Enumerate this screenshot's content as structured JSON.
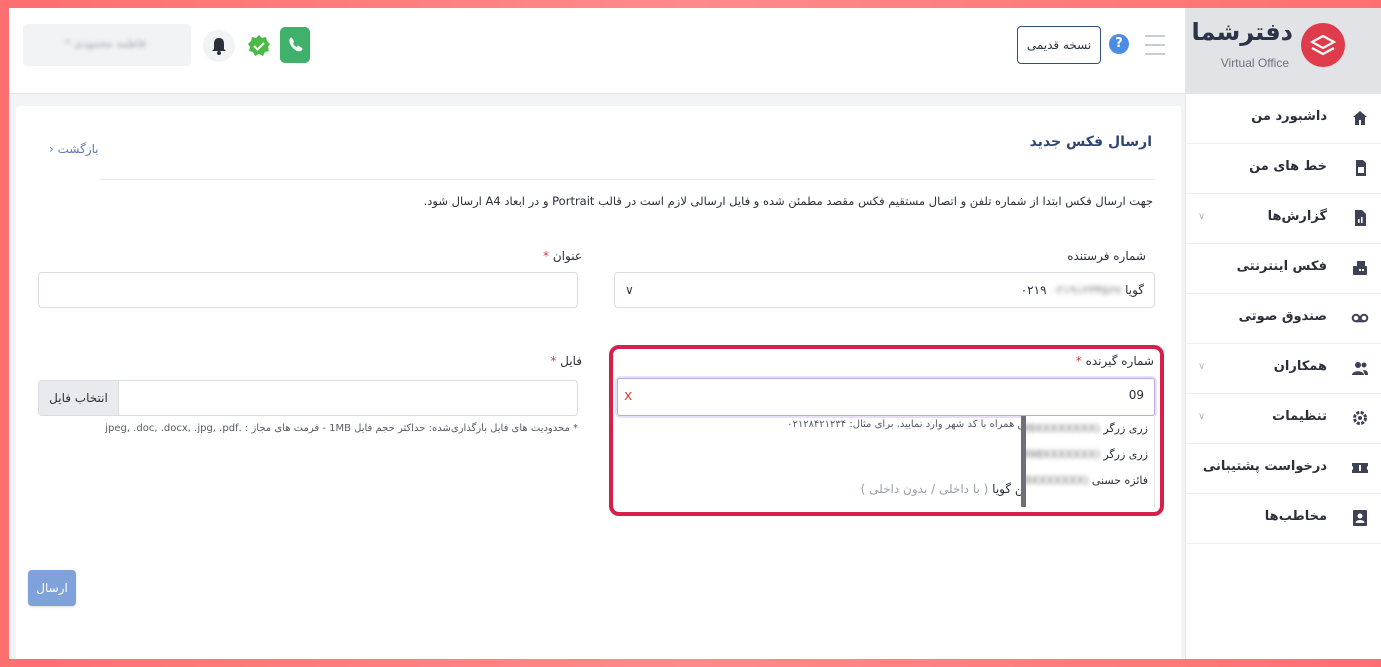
{
  "brand": {
    "name": "دفترشما",
    "subtitle": "Virtual Office",
    "color": "#e03b4b"
  },
  "header": {
    "user_name": "فاطمه محمودی *",
    "old_version_label": "نسخه قدیمی",
    "help_glyph": "?",
    "icons": [
      "menu-icon",
      "help-icon",
      "phone-icon",
      "verified-icon",
      "bell-icon"
    ]
  },
  "sidebar": {
    "items": [
      {
        "label": "داشبورد من",
        "icon": "home-icon",
        "has_submenu": false
      },
      {
        "label": "خط های من",
        "icon": "sim-card-icon",
        "has_submenu": false
      },
      {
        "label": "گزارش‌ها",
        "icon": "report-icon",
        "has_submenu": true
      },
      {
        "label": "فکس اینترنتی",
        "icon": "fax-icon",
        "has_submenu": false
      },
      {
        "label": "صندوق صوتی",
        "icon": "voicemail-icon",
        "has_submenu": false
      },
      {
        "label": "همکاران",
        "icon": "users-icon",
        "has_submenu": true
      },
      {
        "label": "تنظیمات",
        "icon": "gear-icon",
        "has_submenu": true
      },
      {
        "label": "درخواست پشتیبانی",
        "icon": "ticket-icon",
        "has_submenu": false
      },
      {
        "label": "مخاطب‌ها",
        "icon": "contacts-icon",
        "has_submenu": false
      }
    ]
  },
  "page": {
    "title": "ارسال فکس جدید",
    "back_label": "بازگشت",
    "notice": "جهت ارسال فکس ابتدا از شماره تلفن و اتصال مستقیم فکس مقصد مطمئن شده و فایل ارسالی لازم است در قالب Portrait و در ابعاد A4 ارسال شود.",
    "send_label": "ارسال"
  },
  "form": {
    "sender": {
      "label": "شماره فرستنده",
      "value_prefix": "گویا",
      "value_hidden": "۰۲۱۹۱۲۳۴۵۶۷",
      "value_tail": "۰۲۱۹"
    },
    "subject": {
      "label": "عنوان",
      "required": "*",
      "value": ""
    },
    "recipient": {
      "label": "شماره گیرنده",
      "required": "*",
      "value": "09",
      "clear_glyph": "x",
      "hint": "دقیق همراه با کد شهر وارد نمایید. برای مثال: ۰۲۱۲۸۴۲۱۲۳۴",
      "internal_prefix": "به تلفن گویا",
      "internal_suffix": "( با داخلی / بدون داخلی )"
    },
    "file": {
      "label": "فایل",
      "required": "*",
      "button": "انتخاب فایل",
      "hint": "* محدودیت های فایل بارگذاری‌شده: حداکثر حجم فایل 1MB - فرمت های مجاز : .jpeg, .doc, .docx, .jpg, .pdf"
    }
  },
  "dropdown": {
    "options": [
      {
        "name": "زری زرگر",
        "number": "(99XXXXXXXX)"
      },
      {
        "name": "زری زرگر",
        "number": "(998XXXXXXX)"
      },
      {
        "name": "فائزه حسنی",
        "number": "(9XXXXXXX)"
      }
    ]
  },
  "colors": {
    "highlight": "#d81e4a",
    "send_button": "#7ea2d9",
    "phone_button": "#3fb16a"
  }
}
